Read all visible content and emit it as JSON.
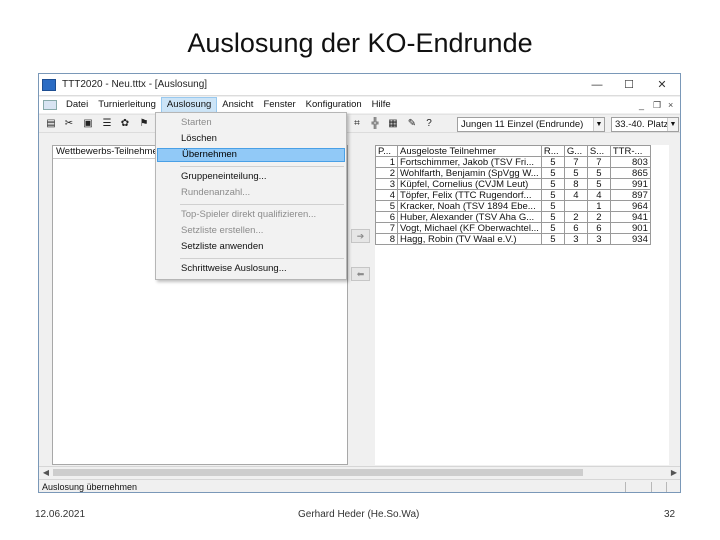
{
  "slide": {
    "title": "Auslosung der KO-Endrunde",
    "footer_date": "12.06.2021",
    "footer_author": "Gerhard Heder (He.So.Wa)",
    "footer_page": "32"
  },
  "window": {
    "title": "TTT2020 - Neu.tttx - [Auslosung]",
    "minimize": "—",
    "maximize": "☐",
    "close": "✕"
  },
  "menubar": {
    "items": [
      "Datei",
      "Turnierleitung",
      "Auslosung",
      "Ansicht",
      "Fenster",
      "Konfiguration",
      "Hilfe"
    ],
    "active_index": 2,
    "child_minimize": "_",
    "child_restore": "❐",
    "child_close": "×"
  },
  "toolbar": {
    "left_icons": [
      "save-icon",
      "tools-icon",
      "document-icon",
      "list-icon",
      "palette-icon",
      "stamp-icon"
    ],
    "right_icons": [
      "grid-icon",
      "table-icon",
      "list-view-icon",
      "edit-icon",
      "help-icon"
    ],
    "combo_round": "Jungen 11 Einzel (Endrunde)",
    "combo_place": "33.-40. Platz"
  },
  "dropdown": {
    "items": [
      {
        "label": "Starten",
        "disabled": true
      },
      {
        "label": "Löschen",
        "disabled": false
      },
      {
        "label": "Übernehmen",
        "disabled": false,
        "highlight": true
      },
      {
        "label": "Gruppeneinteilung...",
        "disabled": false
      },
      {
        "label": "Rundenanzahl...",
        "disabled": true
      },
      {
        "label": "Top-Spieler direkt qualifizieren...",
        "disabled": true
      },
      {
        "label": "Setzliste erstellen...",
        "disabled": true
      },
      {
        "label": "Setzliste anwenden",
        "disabled": false
      },
      {
        "label": "Schrittweise Auslosung...",
        "disabled": false
      }
    ]
  },
  "left_pane": {
    "header": "Wettbewerbs-Teilnehmer"
  },
  "transfer": {
    "right_arrow": "➔",
    "left_arrow": "⬅"
  },
  "participants": {
    "columns": [
      "P...",
      "Ausgeloste Teilnehmer",
      "R...",
      "G...",
      "S...",
      "TTR-..."
    ],
    "rows": [
      [
        "1",
        "Fortschimmer, Jakob (TSV Fri...",
        "5",
        "7",
        "7",
        "803"
      ],
      [
        "2",
        "Wohlfarth, Benjamin (SpVgg W...",
        "5",
        "5",
        "5",
        "865"
      ],
      [
        "3",
        "Küpfel, Cornelius (CVJM Leut)",
        "5",
        "8",
        "5",
        "991"
      ],
      [
        "4",
        "Töpfer, Felix (TTC Rugendorf...",
        "5",
        "4",
        "4",
        "897"
      ],
      [
        "5",
        "Kracker, Noah (TSV 1894 Ebe...",
        "5",
        "",
        "1",
        "964"
      ],
      [
        "6",
        "Huber, Alexander (TSV Aha G...",
        "5",
        "2",
        "2",
        "941"
      ],
      [
        "7",
        "Vogt, Michael (KF Oberwachtel...",
        "5",
        "6",
        "6",
        "901"
      ],
      [
        "8",
        "Hagg, Robin (TV Waal e.V.)",
        "5",
        "3",
        "3",
        "934"
      ]
    ]
  },
  "status": {
    "text": "Auslosung übernehmen"
  },
  "scroll": {
    "left": "◀",
    "right": "▶"
  }
}
